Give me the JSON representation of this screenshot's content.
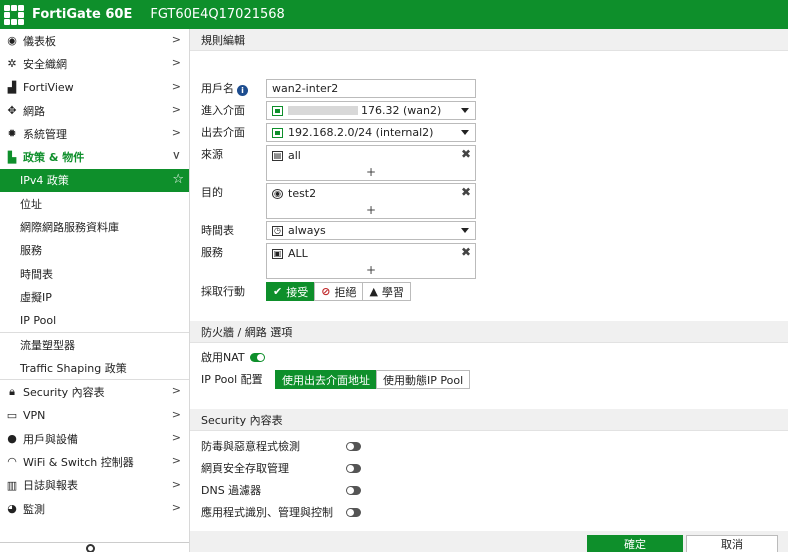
{
  "topbar": {
    "product": "FortiGate 60E",
    "serial": "FGT60E4Q17021568"
  },
  "sidebar": {
    "items": [
      {
        "label": "儀表板",
        "icon": "dashboard-icon"
      },
      {
        "label": "安全織網",
        "icon": "fabric-icon"
      },
      {
        "label": "FortiView",
        "icon": "chart-icon"
      },
      {
        "label": "網路",
        "icon": "network-icon"
      },
      {
        "label": "系統管理",
        "icon": "gear-icon"
      },
      {
        "label": "政策 & 物件",
        "icon": "policy-icon"
      }
    ],
    "sub_items": [
      {
        "label": "IPv4 政策"
      },
      {
        "label": "位址"
      },
      {
        "label": "網際網路服務資料庫"
      },
      {
        "label": "服務"
      },
      {
        "label": "時間表"
      },
      {
        "label": "虛擬IP"
      },
      {
        "label": "IP Pool"
      },
      {
        "label": "流量塑型器"
      },
      {
        "label": "Traffic Shaping 政策"
      }
    ],
    "bottom_items": [
      {
        "label": "Security 內容表",
        "icon": "lock-icon"
      },
      {
        "label": "VPN",
        "icon": "laptop-icon"
      },
      {
        "label": "用戶與設備",
        "icon": "user-icon"
      },
      {
        "label": "WiFi & Switch 控制器",
        "icon": "wifi-icon"
      },
      {
        "label": "日誌與報表",
        "icon": "report-icon"
      },
      {
        "label": "監測",
        "icon": "monitor-icon"
      }
    ]
  },
  "form": {
    "section_title": "規則編輯",
    "username_label": "用戶名",
    "username_value": "wan2-inter2",
    "incoming_label": "進入介面",
    "incoming_value": "176.32 (wan2)",
    "outgoing_label": "出去介面",
    "outgoing_value": "192.168.2.0/24 (internal2)",
    "source_label": "來源",
    "source_value": "all",
    "dest_label": "目的",
    "dest_value": "test2",
    "schedule_label": "時間表",
    "schedule_value": "always",
    "service_label": "服務",
    "service_value": "ALL",
    "action_label": "採取行動",
    "action_accept": "接受",
    "action_deny": "拒絕",
    "action_learn": "學習",
    "add_symbol": "+",
    "remove_symbol": "✖"
  },
  "firewall": {
    "section_title": "防火牆 / 網路 選項",
    "nat_label": "啟用NAT",
    "nat_enabled": true,
    "ippool_label": "IP Pool 配置",
    "ippool_option1": "使用出去介面地址",
    "ippool_option2": "使用動態IP Pool"
  },
  "security": {
    "section_title": "Security 內容表",
    "rows": [
      {
        "label": "防毒與惡意程式檢測",
        "enabled": false
      },
      {
        "label": "網頁安全存取管理",
        "enabled": false
      },
      {
        "label": "DNS 過濾器",
        "enabled": false
      },
      {
        "label": "應用程式識別、管理與控制",
        "enabled": false
      }
    ]
  },
  "footer": {
    "ok_label": "確定",
    "cancel_label": "取消"
  },
  "colors": {
    "brand": "#0e8f2b",
    "panel_header": "#f0f0f0"
  }
}
